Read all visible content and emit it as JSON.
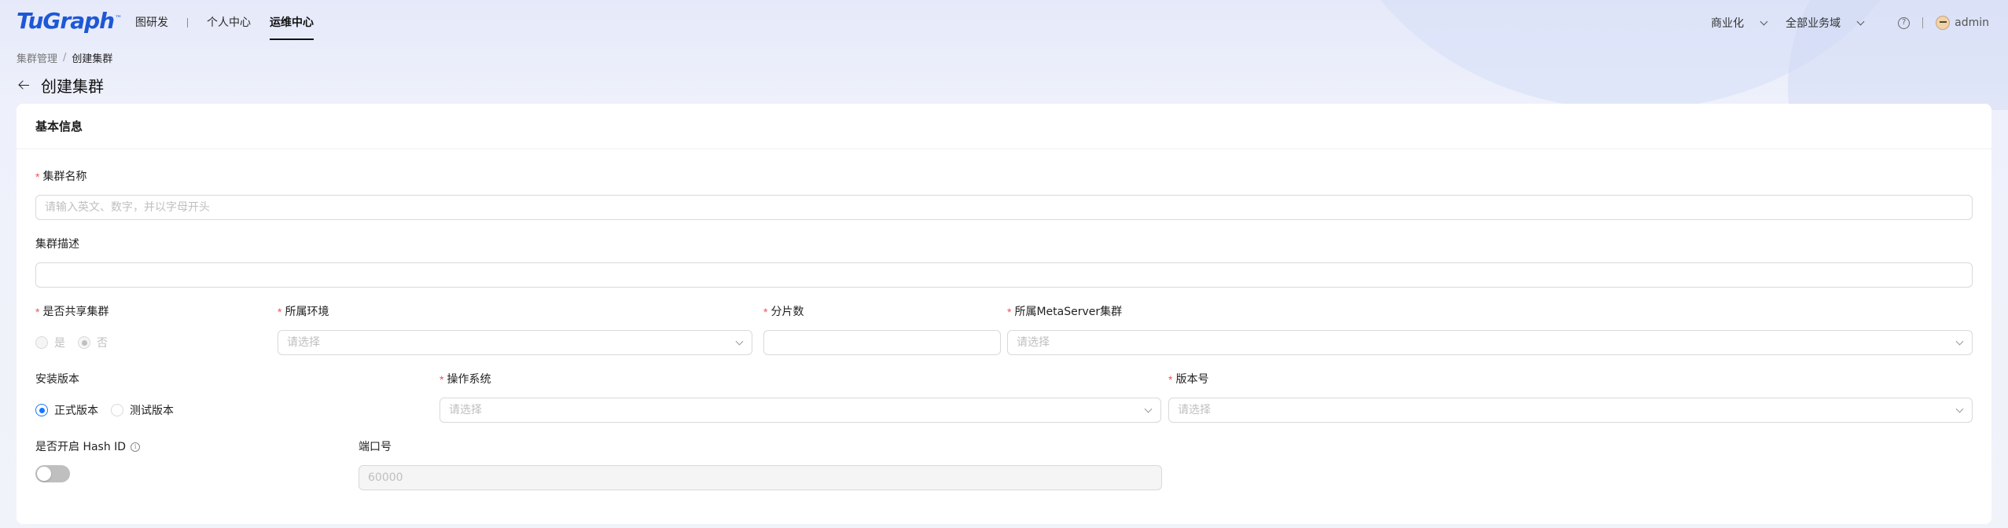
{
  "header": {
    "logo": "TuGraph",
    "logo_tm": "™",
    "nav": [
      "图研发",
      "个人中心",
      "运维中心"
    ],
    "active_nav": "运维中心",
    "commercial_label": "商业化",
    "domain_label": "全部业务域",
    "help_glyph": "?",
    "user_name": "admin"
  },
  "breadcrumb": {
    "parent": "集群管理",
    "separator": "/",
    "current": "创建集群"
  },
  "page": {
    "title": "创建集群"
  },
  "form": {
    "section_title": "基本信息",
    "cluster_name": {
      "label": "集群名称",
      "placeholder": "请输入英文、数字，并以字母开头",
      "required": true
    },
    "cluster_desc": {
      "label": "集群描述",
      "value": ""
    },
    "shared": {
      "label": "是否共享集群",
      "options": [
        "是",
        "否"
      ],
      "selected": "否",
      "disabled": true,
      "required": true
    },
    "env": {
      "label": "所属环境",
      "placeholder": "请选择",
      "required": true
    },
    "shards": {
      "label": "分片数",
      "value": "",
      "required": true
    },
    "metaserver": {
      "label": "所属MetaServer集群",
      "placeholder": "请选择",
      "required": true
    },
    "install_version": {
      "label": "安装版本",
      "options": [
        "正式版本",
        "测试版本"
      ],
      "selected": "正式版本"
    },
    "os": {
      "label": "操作系统",
      "placeholder": "请选择",
      "required": true
    },
    "version_no": {
      "label": "版本号",
      "placeholder": "请选择",
      "required": true
    },
    "hash_id": {
      "label": "是否开启 Hash ID",
      "enabled": false,
      "info_glyph": "i"
    },
    "port": {
      "label": "端口号",
      "value": "60000",
      "disabled": true
    }
  },
  "colors": {
    "accent": "#1677ff",
    "logo": "#1e57d6",
    "required": "#ff4d4f"
  }
}
